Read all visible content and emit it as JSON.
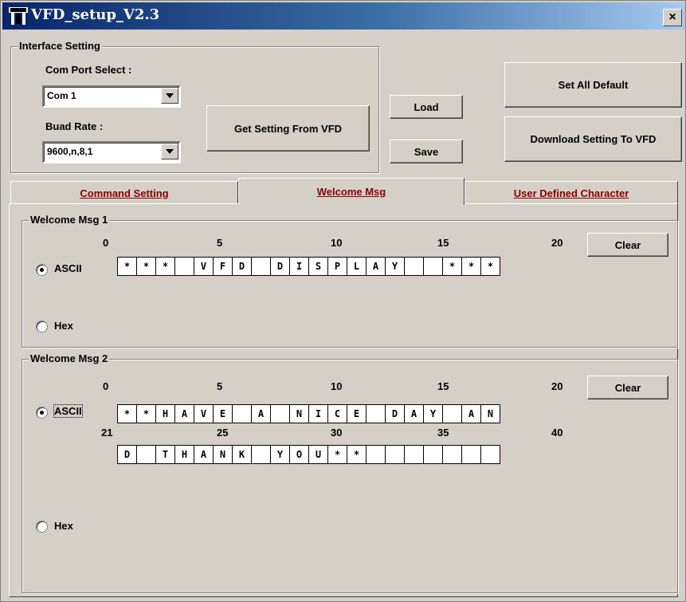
{
  "window": {
    "title": "VFD_setup_V2.3",
    "close_label": "×"
  },
  "interface": {
    "group_label": "Interface Setting",
    "com_port_label": "Com Port Select :",
    "com_port_value": "Com 1",
    "baud_label": "Buad Rate :",
    "baud_value": "9600,n,8,1",
    "get_setting_label": "Get Setting From VFD"
  },
  "toolbar": {
    "load_label": "Load",
    "save_label": "Save",
    "set_default_label": "Set All Default",
    "download_label": "Download Setting To VFD"
  },
  "tabs": [
    {
      "label": "Command Setting"
    },
    {
      "label": "Welcome Msg"
    },
    {
      "label": "User Defined Character"
    }
  ],
  "msg1": {
    "group_label": "Welcome Msg 1",
    "ruler": [
      "0",
      "5",
      "10",
      "15",
      "20"
    ],
    "ascii_label": "ASCII",
    "hex_label": "Hex",
    "clear_label": "Clear",
    "chars": [
      "*",
      "*",
      "*",
      "",
      "V",
      "F",
      "D",
      "",
      "D",
      "I",
      "S",
      "P",
      "L",
      "A",
      "Y",
      "",
      "",
      "*",
      "*",
      "*"
    ]
  },
  "msg2": {
    "group_label": "Welcome Msg 2",
    "ruler1": [
      "0",
      "5",
      "10",
      "15",
      "20"
    ],
    "ruler2": [
      "21",
      "25",
      "30",
      "35",
      "40"
    ],
    "ascii_label": "ASCII",
    "hex_label": "Hex",
    "clear_label": "Clear",
    "row1": [
      "*",
      "*",
      "H",
      "A",
      "V",
      "E",
      "",
      "A",
      "",
      "N",
      "I",
      "C",
      "E",
      "",
      "D",
      "A",
      "Y",
      "",
      "A",
      "N"
    ],
    "row2": [
      "D",
      "",
      "T",
      "H",
      "A",
      "N",
      "K",
      "",
      "Y",
      "O",
      "U",
      "*",
      "*",
      "",
      "",
      "",
      "",
      "",
      "",
      ""
    ]
  }
}
